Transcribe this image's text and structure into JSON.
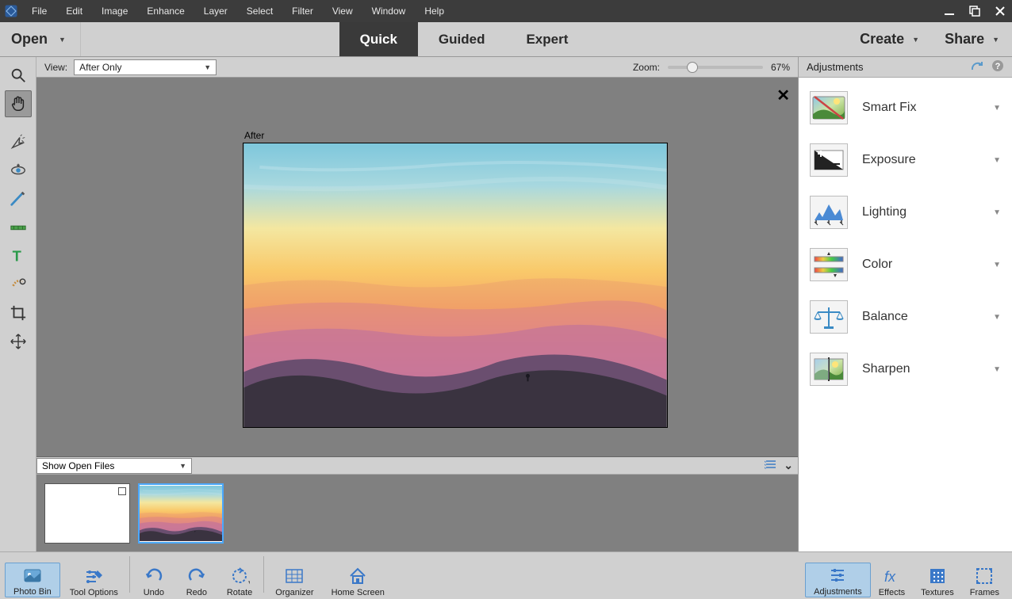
{
  "menubar": {
    "items": [
      "File",
      "Edit",
      "Image",
      "Enhance",
      "Layer",
      "Select",
      "Filter",
      "View",
      "Window",
      "Help"
    ]
  },
  "modebar": {
    "open": "Open",
    "tabs": [
      "Quick",
      "Guided",
      "Expert"
    ],
    "active": "Quick",
    "create": "Create",
    "share": "Share"
  },
  "viewbar": {
    "label": "View:",
    "select_value": "After Only",
    "zoom_label": "Zoom:",
    "zoom_value": "67%"
  },
  "canvas": {
    "after_label": "After"
  },
  "photobin": {
    "select_value": "Show Open Files"
  },
  "adjustments": {
    "title": "Adjustments",
    "rows": [
      {
        "label": "Smart Fix"
      },
      {
        "label": "Exposure"
      },
      {
        "label": "Lighting"
      },
      {
        "label": "Color"
      },
      {
        "label": "Balance"
      },
      {
        "label": "Sharpen"
      }
    ]
  },
  "bottombar": {
    "left": [
      {
        "label": "Photo Bin"
      },
      {
        "label": "Tool Options"
      },
      {
        "label": "Undo"
      },
      {
        "label": "Redo"
      },
      {
        "label": "Rotate"
      },
      {
        "label": "Organizer"
      },
      {
        "label": "Home Screen"
      }
    ],
    "right": [
      {
        "label": "Adjustments"
      },
      {
        "label": "Effects"
      },
      {
        "label": "Textures"
      },
      {
        "label": "Frames"
      }
    ]
  }
}
